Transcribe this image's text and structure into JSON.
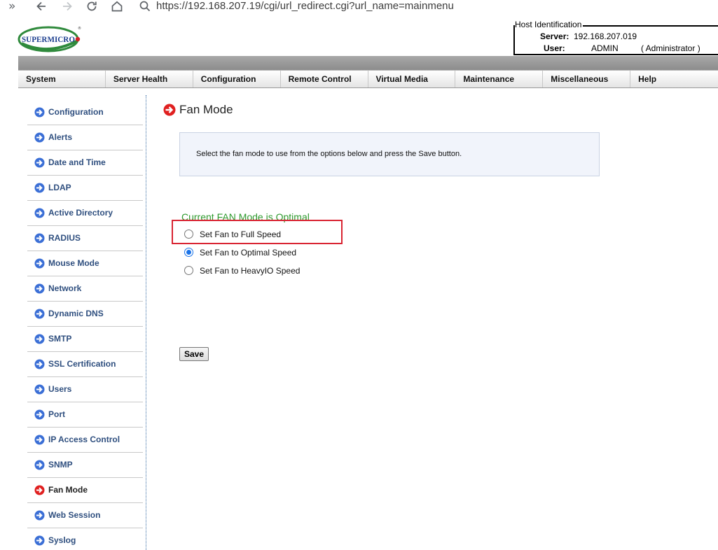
{
  "browser": {
    "url": "https://192.168.207.19/cgi/url_redirect.cgi?url_name=mainmenu"
  },
  "header": {
    "logo_text": "SUPERMICRO",
    "host_title": "Host Identification",
    "server_label": "Server:",
    "server_value": "192.168.207.019",
    "user_label": "User:",
    "user_value": "ADMIN",
    "user_role": "( Administrator )"
  },
  "menu": [
    {
      "label": "System"
    },
    {
      "label": "Server Health"
    },
    {
      "label": "Configuration"
    },
    {
      "label": "Remote Control"
    },
    {
      "label": "Virtual Media"
    },
    {
      "label": "Maintenance"
    },
    {
      "label": "Miscellaneous"
    },
    {
      "label": "Help"
    }
  ],
  "sidebar": {
    "items": [
      {
        "label": "Configuration"
      },
      {
        "label": "Alerts"
      },
      {
        "label": "Date and Time"
      },
      {
        "label": "LDAP"
      },
      {
        "label": "Active Directory"
      },
      {
        "label": "RADIUS"
      },
      {
        "label": "Mouse Mode"
      },
      {
        "label": "Network"
      },
      {
        "label": "Dynamic DNS"
      },
      {
        "label": "SMTP"
      },
      {
        "label": "SSL Certification"
      },
      {
        "label": "Users"
      },
      {
        "label": "Port"
      },
      {
        "label": "IP Access Control"
      },
      {
        "label": "SNMP"
      },
      {
        "label": "Fan Mode"
      },
      {
        "label": "Web Session"
      },
      {
        "label": "Syslog"
      }
    ],
    "active_index": 15
  },
  "main": {
    "title": "Fan Mode",
    "instruction": "Select the fan mode to use from the options below and press the Save button.",
    "current_mode": "Current FAN Mode is Optimal",
    "options": [
      {
        "label": "Set Fan to Full Speed",
        "checked": false
      },
      {
        "label": "Set Fan to Optimal Speed",
        "checked": true
      },
      {
        "label": "Set Fan to HeavyIO Speed",
        "checked": false
      }
    ],
    "save_label": "Save"
  },
  "colors": {
    "menu_active_accent": "#2f4f7f",
    "current_mode_text": "#2e9a2e",
    "highlight_box": "#d92432",
    "nav_arrow_blue": "#3b6fd6",
    "nav_arrow_active": "#e02020"
  },
  "icons": {
    "sidebar_item": "circle-arrow-right-icon",
    "sidebar_active": "red-circle-arrow-right-icon",
    "title": "red-circle-arrow-right-icon"
  }
}
